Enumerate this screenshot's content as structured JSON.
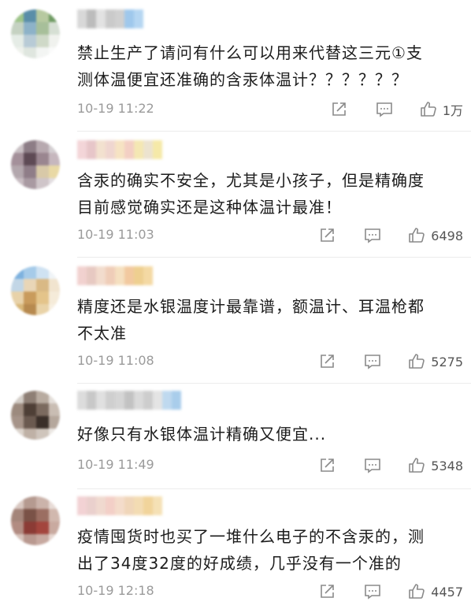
{
  "comments": [
    {
      "text_line1": "禁止生产了请问有什么可以用来代替这三元①支",
      "text_line2": "测体温便宜还准确的含汞体温计？？？？？？",
      "time": "10-19 11:22",
      "likes": "1万",
      "avatar_colors": [
        "#9ec48a",
        "#5a8ea8",
        "#b7c9a0",
        "#6f9b63",
        "#c5d2c2",
        "#8db2c8",
        "#a7bf9a",
        "#d6dfd4",
        "#e5ece6",
        "#b8cbd6",
        "#cfd9c8",
        "#f0f2ee",
        "#eef1ec",
        "#dfe6df",
        "#f3f5f3",
        "#fafbfa"
      ],
      "name_colors": [
        "#d8d8d8",
        "#bcbcbc",
        "#e2e2e2",
        "#cacaca",
        "#d0d0d0",
        "#9fc8ec",
        "#b5d6f2"
      ]
    },
    {
      "text_line1": "含汞的确实不安全，尤其是小孩子，但是精确度",
      "text_line2": "目前感觉确实还是这种体温计最准！",
      "time": "10-19 11:03",
      "likes": "6498",
      "avatar_colors": [
        "#c9c0c4",
        "#8d7d86",
        "#b7a9af",
        "#d4cfd2",
        "#a4909a",
        "#5e4a55",
        "#9a8690",
        "#c6b7be",
        "#b3a7ad",
        "#8f7d88",
        "#d8c9a8",
        "#e9d9a5",
        "#c8bcc2",
        "#a99aa2",
        "#cfc5c9",
        "#e2dde0"
      ],
      "name_colors": [
        "#f3d5d8",
        "#e7c6c9",
        "#f2e1cf",
        "#efd6d0",
        "#f6e3c3",
        "#f3cfc4",
        "#f4e7b3",
        "#ece3cf",
        "#f5e9a8"
      ]
    },
    {
      "text_line1": "精度还是水银温度计最靠谱，额温计、耳温枪都",
      "text_line2": "不太准",
      "time": "10-19 11:08",
      "likes": "5275",
      "avatar_colors": [
        "#7db1de",
        "#a6cbe9",
        "#cfe2f2",
        "#f0f4f7",
        "#c2d6e6",
        "#e9d6b7",
        "#d9b985",
        "#f1e4cf",
        "#e8d2a9",
        "#c99b5c",
        "#e4c48a",
        "#f5ebd9",
        "#d8b779",
        "#b78a4f",
        "#e9d3a8",
        "#f7efe1"
      ],
      "name_colors": [
        "#f1d1cf",
        "#e7c9c2",
        "#f2dccd",
        "#efcdb8",
        "#f5e0c0",
        "#f2c99f",
        "#eecf90",
        "#f4d9a4"
      ]
    },
    {
      "text_line1": "好像只有水银体温计精确又便宜...",
      "text_line2": "",
      "time": "10-19 11:49",
      "likes": "5348",
      "avatar_colors": [
        "#d3cdc7",
        "#8e7f75",
        "#b8aba0",
        "#e4dfda",
        "#9c8a7e",
        "#4e3f36",
        "#7b6a5f",
        "#c9bdb3",
        "#a69489",
        "#6b5a50",
        "#3a2f29",
        "#b5a79c",
        "#dcd4cd",
        "#bfb1a6",
        "#cfc5bc",
        "#ece8e4"
      ],
      "name_colors": [
        "#dcdcdc",
        "#c8c8c8",
        "#e0e0e0",
        "#cfcfcf",
        "#d5d5d5",
        "#c2c2c2",
        "#dadada",
        "#cdcdcd",
        "#e4e4e4",
        "#bfd9ef",
        "#a9cdeb"
      ]
    },
    {
      "text_line1": "疫情囤货时也买了一堆什么电子的不含汞的，测",
      "text_line2": "出了34度32度的好成绩，几乎没有一个准的",
      "time": "10-19 12:18",
      "likes": "4457",
      "avatar_colors": [
        "#d9c8c2",
        "#b59a90",
        "#cbb3aa",
        "#e8dcd7",
        "#a4857a",
        "#7a5247",
        "#9b6e62",
        "#d1b8ae",
        "#b28c82",
        "#8b3b35",
        "#a3453d",
        "#c9aaa0",
        "#d6c2ba",
        "#b99990",
        "#c7a9a0",
        "#e6d7d1"
      ],
      "name_colors": [
        "#f2d2d4",
        "#ead0cd",
        "#f0d9cf",
        "#f3cfc7",
        "#f4dccb",
        "#f0d6b9",
        "#f3dcb3",
        "#f1d49b",
        "#f5e1b5"
      ]
    }
  ]
}
